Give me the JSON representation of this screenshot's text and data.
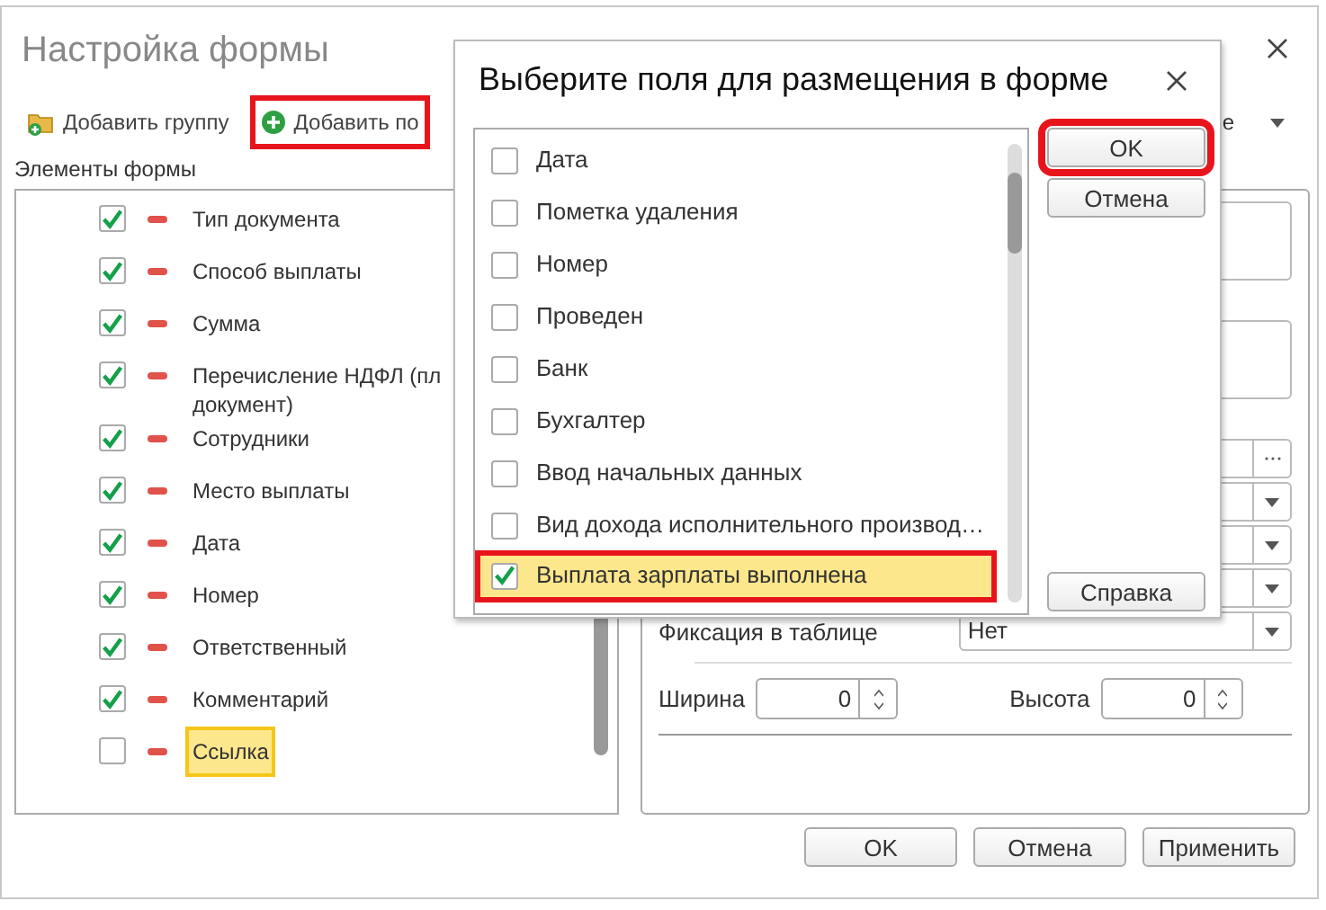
{
  "window": {
    "title": "Настройка формы"
  },
  "toolbar": [
    {
      "label": "Добавить группу",
      "kind": "group",
      "annotated": false
    },
    {
      "label": "Добавить по",
      "kind": "field",
      "annotated": true
    }
  ],
  "toolbar_right": {
    "label": "е"
  },
  "elements_label": "Элементы формы",
  "elements": [
    {
      "label": "Тип документа",
      "checked": true,
      "selected": false
    },
    {
      "label": "Способ выплаты",
      "checked": true,
      "selected": false
    },
    {
      "label": "Сумма",
      "checked": true,
      "selected": false
    },
    {
      "label": "Перечисление НДФЛ (пл\nдокумент)",
      "checked": true,
      "selected": false
    },
    {
      "label": "Сотрудники",
      "checked": true,
      "selected": false
    },
    {
      "label": "Место выплаты",
      "checked": true,
      "selected": false
    },
    {
      "label": "Дата",
      "checked": true,
      "selected": false
    },
    {
      "label": "Номер",
      "checked": true,
      "selected": false
    },
    {
      "label": "Ответственный",
      "checked": true,
      "selected": false
    },
    {
      "label": "Комментарий",
      "checked": true,
      "selected": false
    },
    {
      "label": "Ссылка",
      "checked": false,
      "selected": true
    }
  ],
  "properties": {
    "fixation": {
      "label": "Фиксация в таблице",
      "value": "Нет"
    },
    "width": {
      "label": "Ширина",
      "value": "0"
    },
    "height": {
      "label": "Высота",
      "value": "0"
    }
  },
  "buttons": [
    "OK",
    "Отмена",
    "Применить"
  ],
  "dialog": {
    "title": "Выберите поля для размещения в форме",
    "fields": [
      {
        "label": "Дата",
        "checked": false,
        "selected": false,
        "annotated": false
      },
      {
        "label": "Пометка удаления",
        "checked": false,
        "selected": false,
        "annotated": false
      },
      {
        "label": "Номер",
        "checked": false,
        "selected": false,
        "annotated": false
      },
      {
        "label": "Проведен",
        "checked": false,
        "selected": false,
        "annotated": false
      },
      {
        "label": "Банк",
        "checked": false,
        "selected": false,
        "annotated": false
      },
      {
        "label": "Бухгалтер",
        "checked": false,
        "selected": false,
        "annotated": false
      },
      {
        "label": "Ввод начальных данных",
        "checked": false,
        "selected": false,
        "annotated": false
      },
      {
        "label": "Вид дохода исполнительного производ…",
        "checked": false,
        "selected": false,
        "annotated": false
      },
      {
        "label": "Выплата зарплаты выполнена",
        "checked": true,
        "selected": true,
        "annotated": true
      }
    ],
    "buttons": [
      {
        "label": "OK",
        "annotated": true
      },
      {
        "label": "Отмена",
        "annotated": false
      },
      {
        "label": "Справка",
        "annotated": false
      }
    ]
  }
}
